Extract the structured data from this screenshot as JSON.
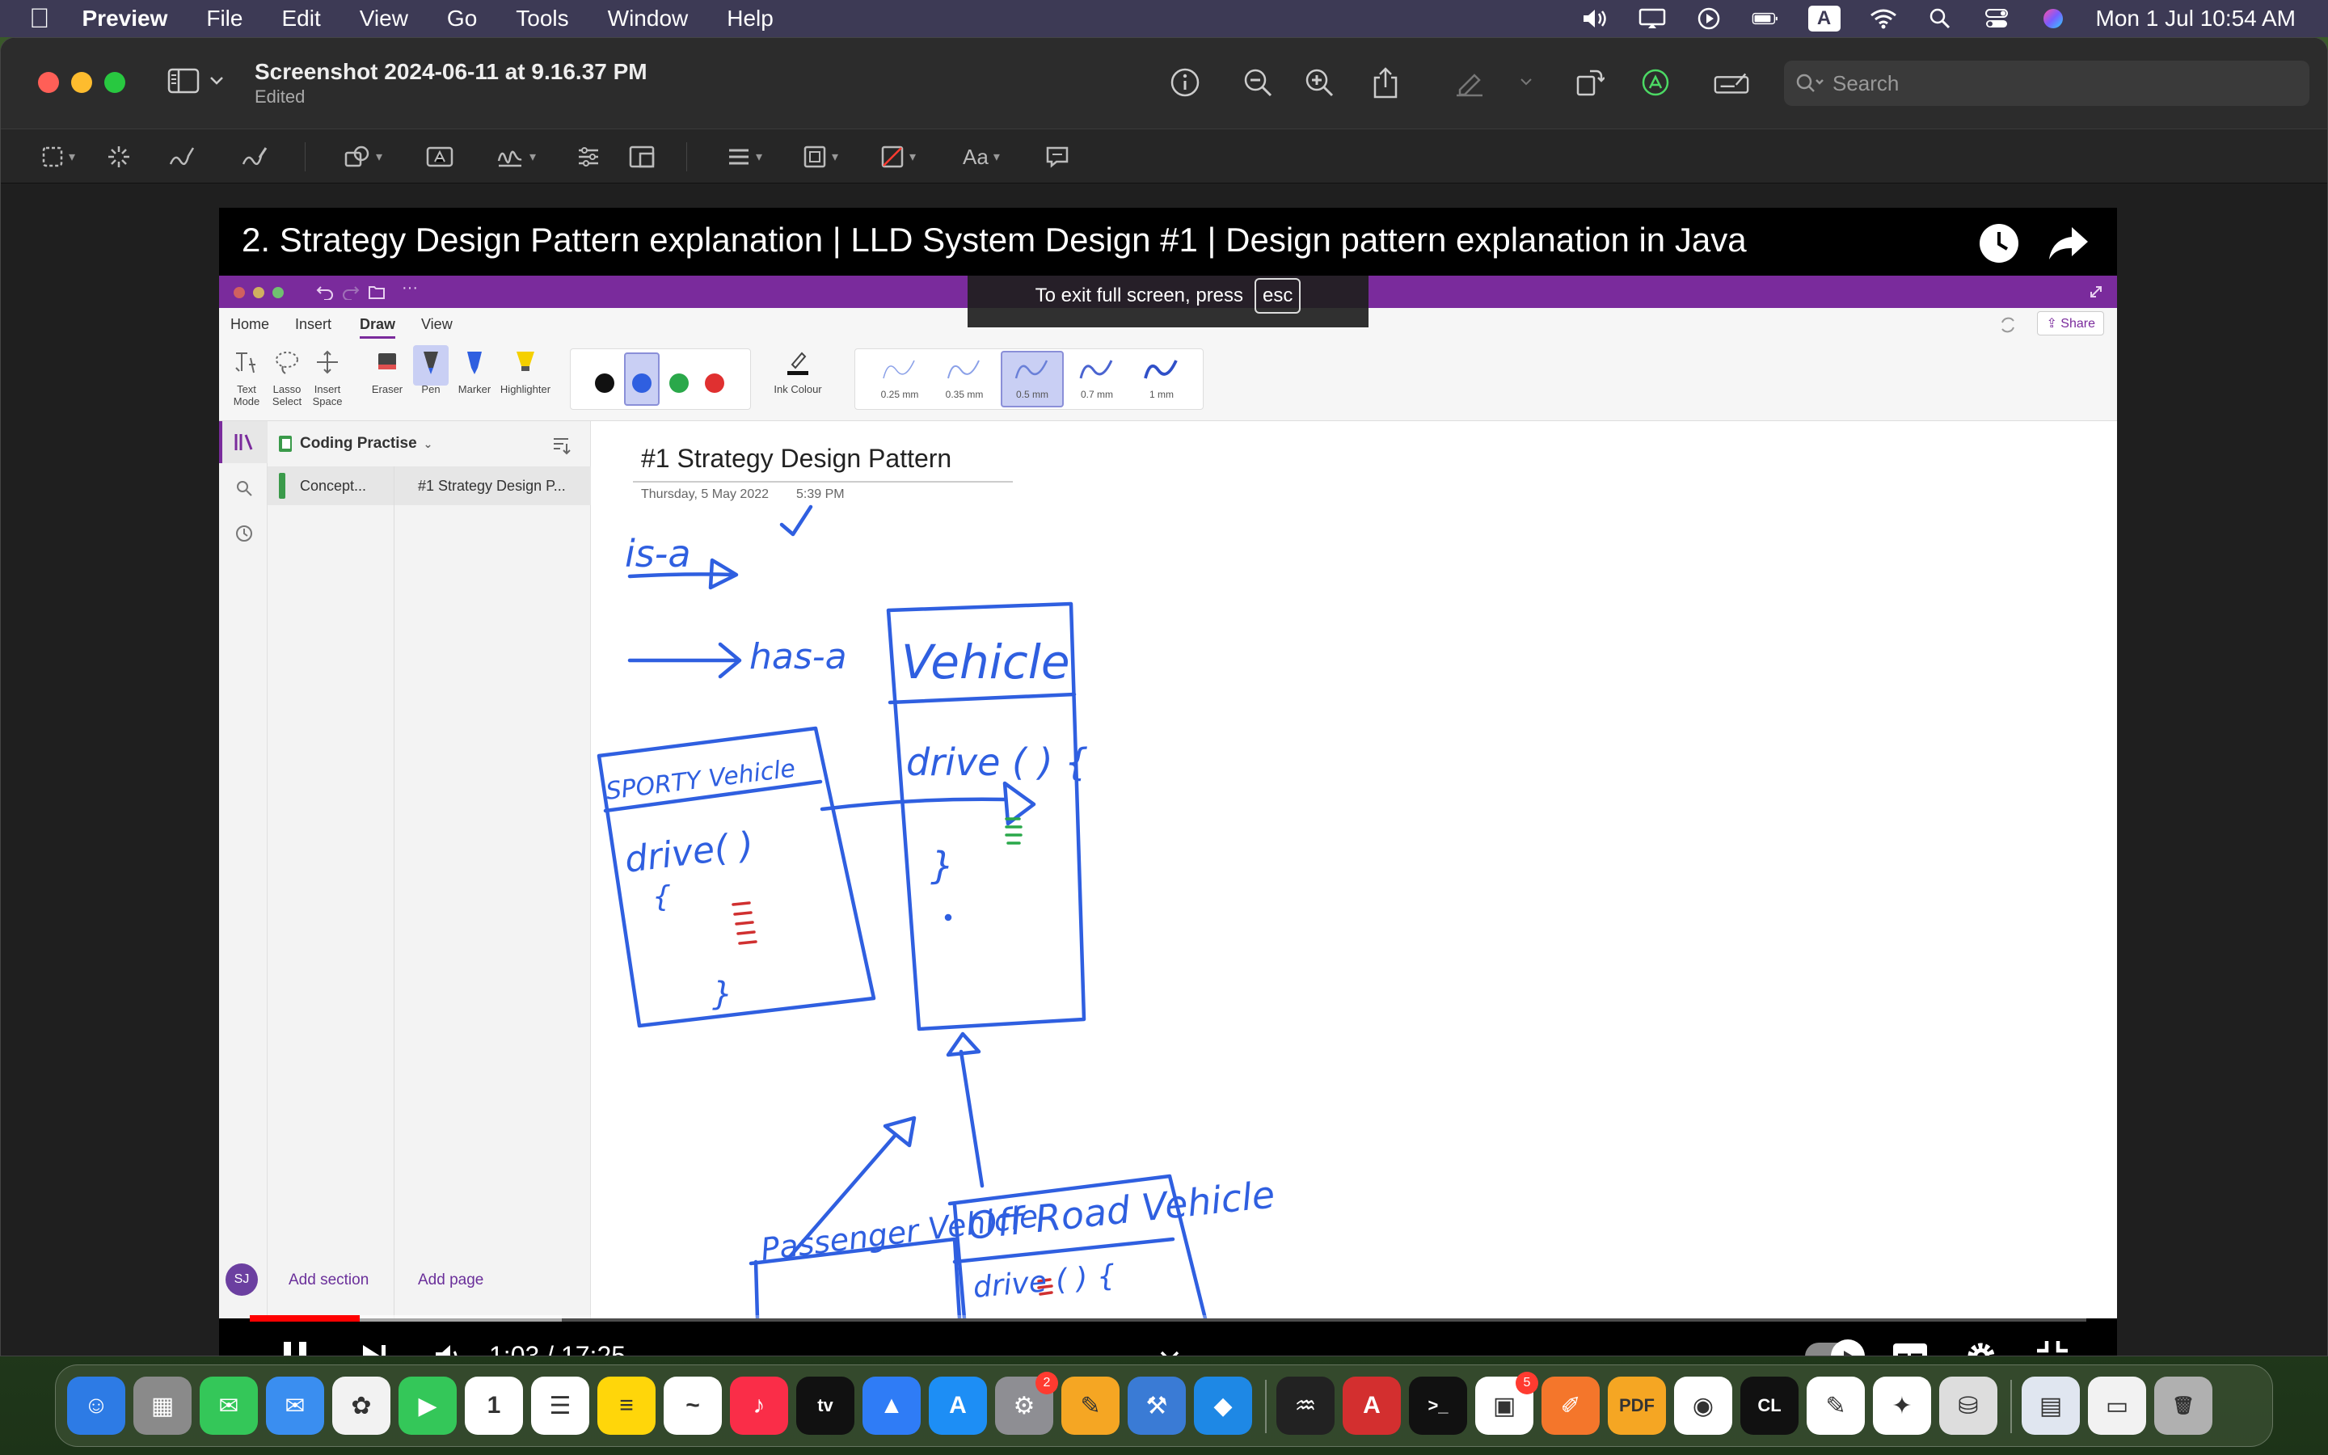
{
  "menubar": {
    "app_name": "Preview",
    "menus": [
      "File",
      "Edit",
      "View",
      "Go",
      "Tools",
      "Window",
      "Help"
    ],
    "input_source": "A",
    "datetime": "Mon 1 Jul  10:54 AM"
  },
  "window": {
    "title": "Screenshot 2024-06-11 at 9.16.37 PM",
    "subtitle": "Edited",
    "search_placeholder": "Search"
  },
  "video": {
    "title": "2. Strategy Design Pattern explanation | LLD System Design #1 | Design pattern explanation in Java",
    "fullscreen_notice": "To exit full screen, press",
    "fullscreen_key": "esc",
    "time": "1:03 / 17:25",
    "progress_fraction": 0.06,
    "buffer_fraction": 0.17
  },
  "onenote": {
    "tabs": [
      "Home",
      "Insert",
      "Draw",
      "View"
    ],
    "active_tab": "Draw",
    "share_label": "Share",
    "tools": [
      {
        "label": "Text Mode",
        "icon": "text-mode-icon"
      },
      {
        "label": "Lasso Select",
        "icon": "lasso-icon"
      },
      {
        "label": "Insert Space",
        "icon": "insert-space-icon"
      },
      {
        "label": "Eraser",
        "icon": "eraser-icon"
      },
      {
        "label": "Pen",
        "icon": "pen-icon"
      },
      {
        "label": "Marker",
        "icon": "marker-icon"
      },
      {
        "label": "Highlighter",
        "icon": "highlighter-icon"
      }
    ],
    "ink_colour_label": "Ink Colour",
    "colors": [
      "#111111",
      "#2f5fe0",
      "#2aa84a",
      "#e03030"
    ],
    "selected_color": "#2f5fe0",
    "stroke_sizes": [
      "0.25 mm",
      "0.35 mm",
      "0.5 mm",
      "0.7 mm",
      "1 mm"
    ],
    "selected_stroke": "0.5 mm",
    "notebook": "Coding Practise",
    "section": "Concept...",
    "page": "#1 Strategy Design P...",
    "add_section": "Add section",
    "add_page": "Add page",
    "user_initials": "SJ",
    "page_title": "#1 Strategy Design Pattern",
    "page_date": "Thursday, 5 May 2022",
    "page_time": "5:39 PM",
    "ink_texts": {
      "is_a": "is-a",
      "has_a": "has-a",
      "vehicle": "Vehicle",
      "vehicle_method": "drive ( ) {",
      "vehicle_close": "}",
      "sporty": "SPORTY Vehicle",
      "sporty_method": "drive( )",
      "sporty_open": "{",
      "sporty_close": "}",
      "passenger": "Passenger Vehicle",
      "offroad": "Off Road Vehicle",
      "offroad_method": "drive ( ) {"
    }
  },
  "dock": {
    "apps": [
      {
        "name": "finder",
        "color": "#2d7be5",
        "glyph": "☺"
      },
      {
        "name": "launchpad",
        "color": "#8a8a8a",
        "glyph": "▦"
      },
      {
        "name": "messages",
        "color": "#34c759",
        "glyph": "✉"
      },
      {
        "name": "mail",
        "color": "#3a8ef0",
        "glyph": "✉"
      },
      {
        "name": "photos",
        "color": "#f2f2f2",
        "glyph": "✿"
      },
      {
        "name": "facetime",
        "color": "#34c759",
        "glyph": "▶"
      },
      {
        "name": "calendar",
        "color": "#ffffff",
        "glyph": "1"
      },
      {
        "name": "reminders",
        "color": "#ffffff",
        "glyph": "☰"
      },
      {
        "name": "notes",
        "color": "#ffd60a",
        "glyph": "≡"
      },
      {
        "name": "freeform",
        "color": "#ffffff",
        "glyph": "~"
      },
      {
        "name": "music",
        "color": "#fa2d48",
        "glyph": "♪"
      },
      {
        "name": "tv",
        "color": "#111111",
        "glyph": "tv"
      },
      {
        "name": "keynote",
        "color": "#2f7cf6",
        "glyph": "▲"
      },
      {
        "name": "app-store",
        "color": "#1d8ef5",
        "glyph": "A"
      },
      {
        "name": "system-settings",
        "color": "#8e8e93",
        "glyph": "⚙",
        "badge": "2"
      },
      {
        "name": "pages",
        "color": "#f5a623",
        "glyph": "✎"
      },
      {
        "name": "xcode",
        "color": "#3a7bd5",
        "glyph": "⚒"
      },
      {
        "name": "vscode",
        "color": "#1e88e5",
        "glyph": "◆"
      },
      {
        "name": "activity-monitor",
        "color": "#222222",
        "glyph": "♒"
      },
      {
        "name": "acrobat",
        "color": "#d32f2f",
        "glyph": "A"
      },
      {
        "name": "terminal",
        "color": "#111111",
        "glyph": ">_"
      },
      {
        "name": "shop",
        "color": "#ffffff",
        "glyph": "▣",
        "badge": "5"
      },
      {
        "name": "sketch",
        "color": "#f4762b",
        "glyph": "✐"
      },
      {
        "name": "pdf-app",
        "color": "#f5a623",
        "glyph": "PDF"
      },
      {
        "name": "chrome",
        "color": "#ffffff",
        "glyph": "◉"
      },
      {
        "name": "clion",
        "color": "#111111",
        "glyph": "CL"
      },
      {
        "name": "textedit",
        "color": "#ffffff",
        "glyph": "✎"
      },
      {
        "name": "colorsync",
        "color": "#ffffff",
        "glyph": "✦"
      },
      {
        "name": "disk-utility",
        "color": "#dddddd",
        "glyph": "⛁"
      },
      {
        "name": "document-stack",
        "color": "#e0e6f0",
        "glyph": "▤"
      },
      {
        "name": "downloads-stack",
        "color": "#f2f2f2",
        "glyph": "▭"
      },
      {
        "name": "trash",
        "color": "#b0b0b0",
        "glyph": "🗑"
      }
    ]
  }
}
